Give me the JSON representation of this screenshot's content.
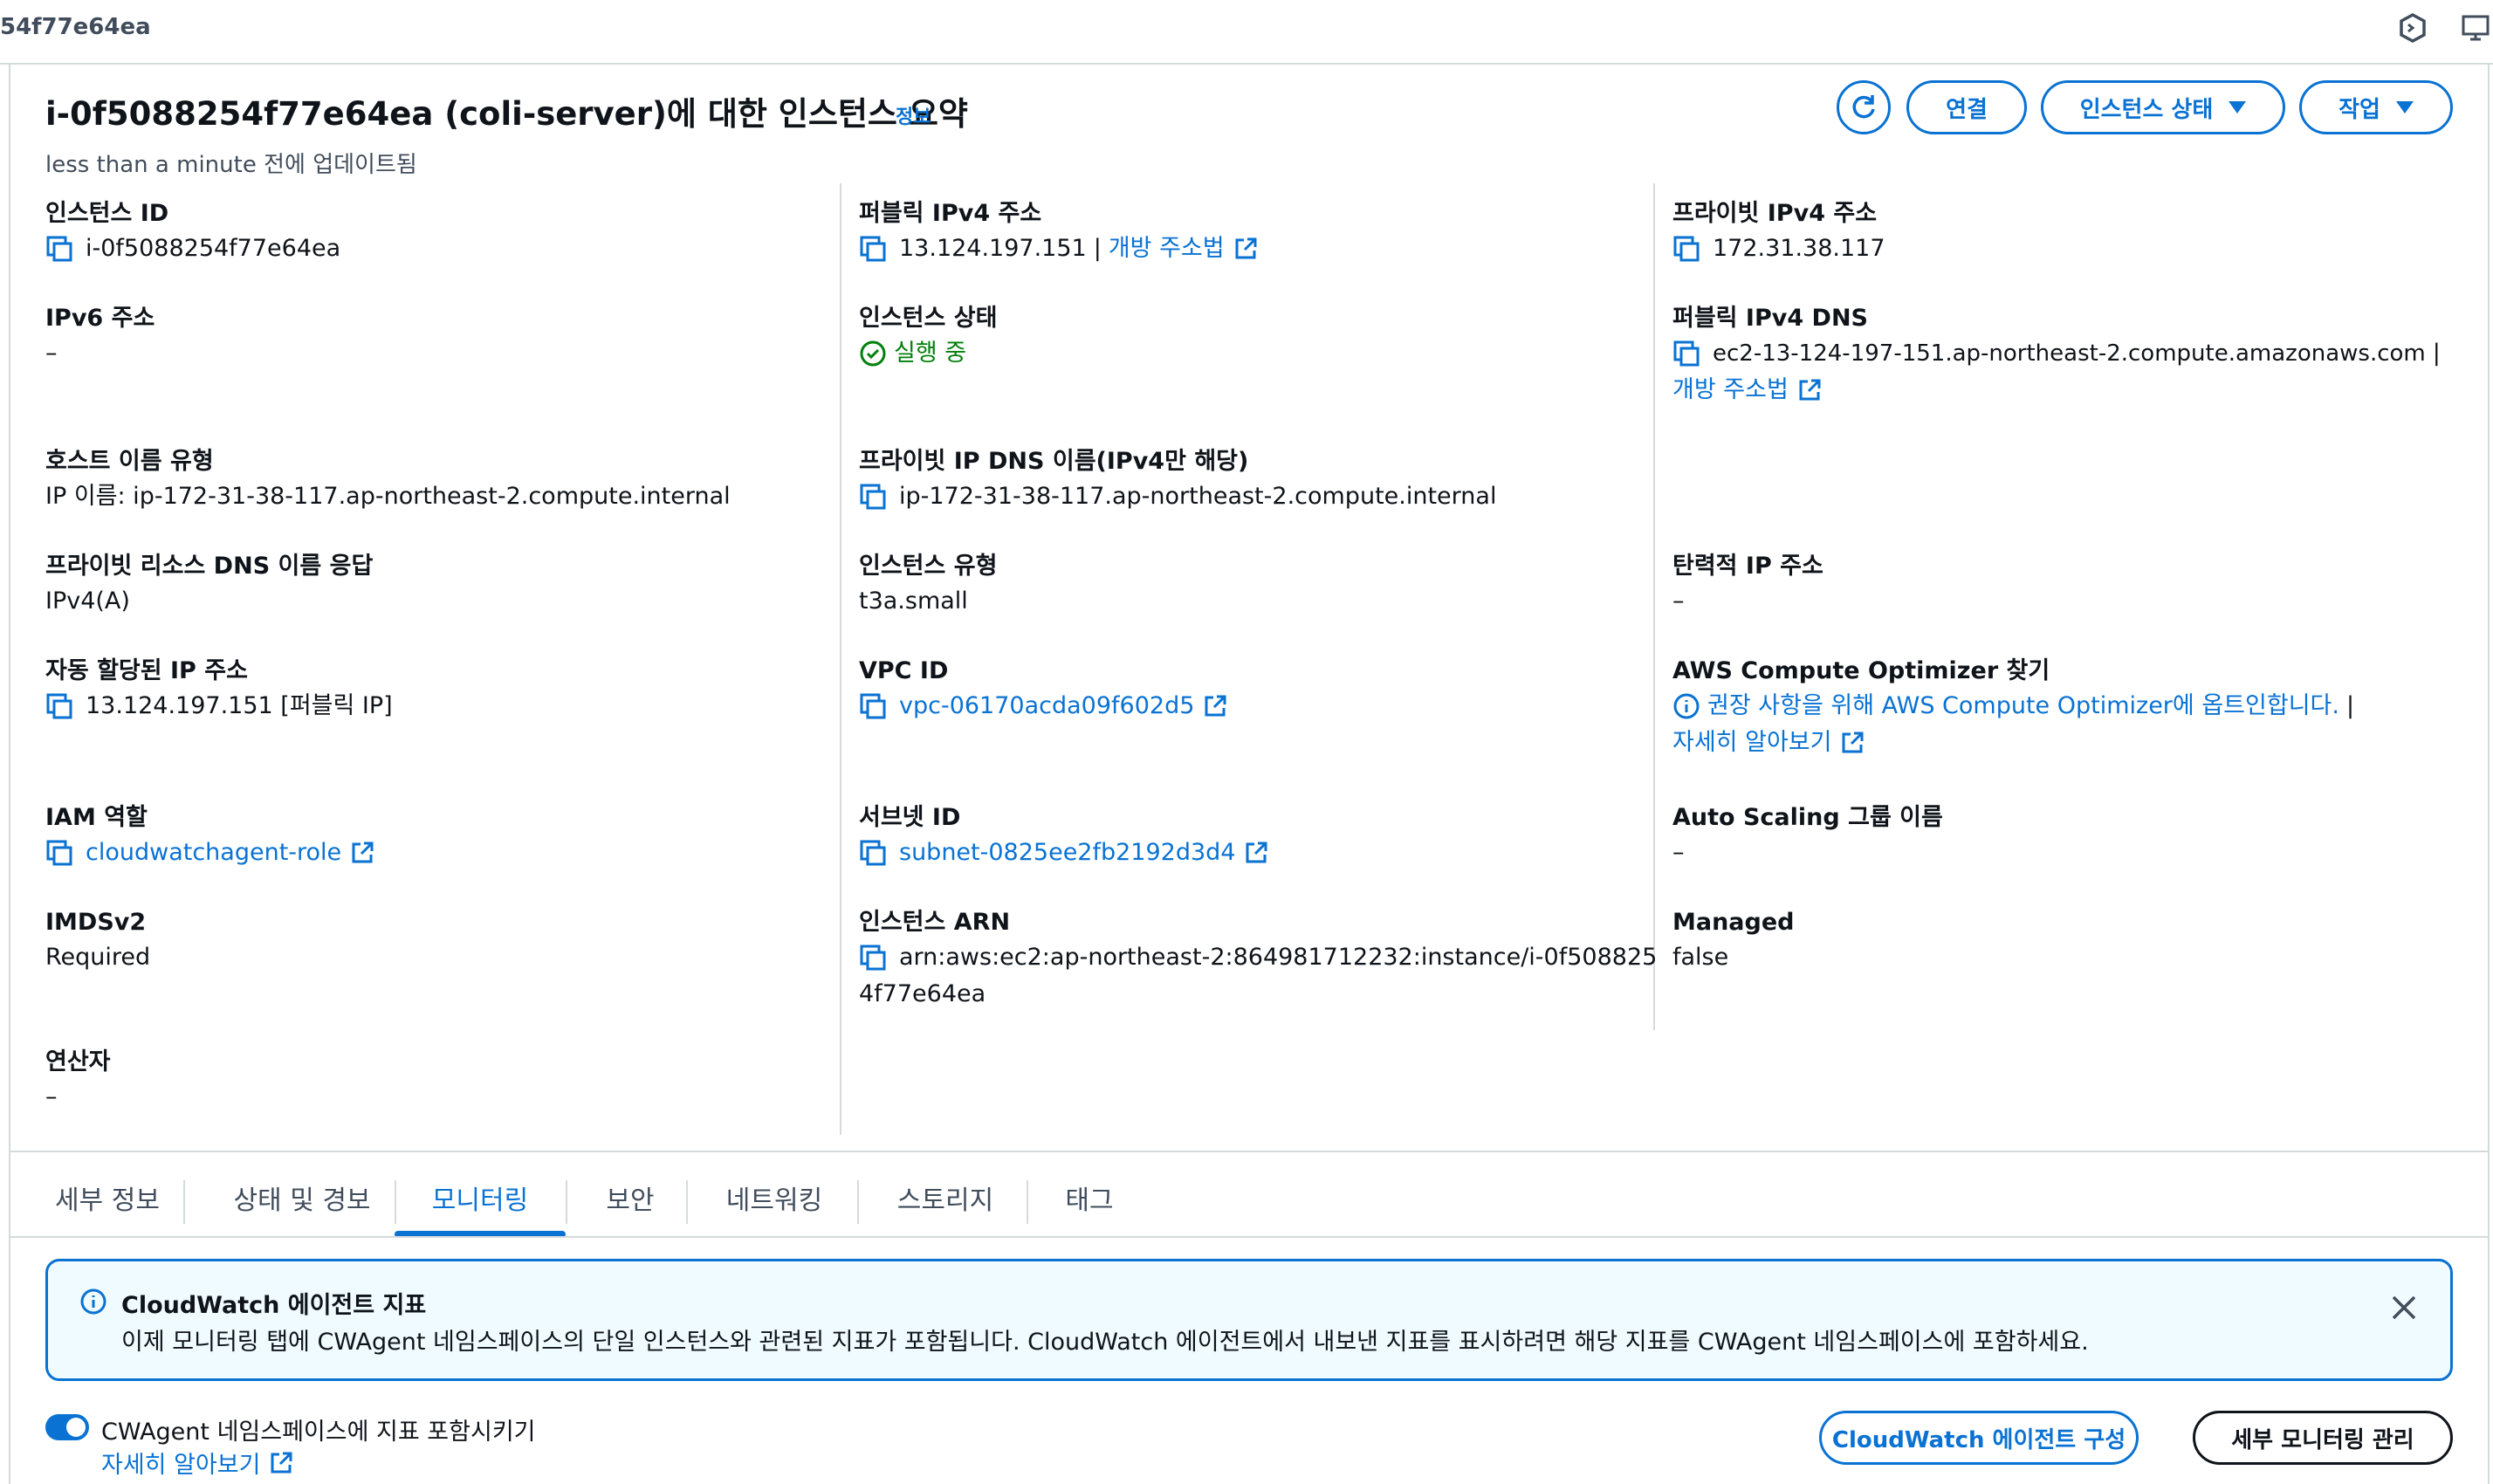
{
  "topbar": {
    "instance_id_fragment": "54f77e64ea"
  },
  "header": {
    "title": "i-0f5088254f77e64ea (coli-server)에 대한 인스턴스 요약",
    "info_link": "정보",
    "updated": "less than a minute 전에 업데이트됨",
    "buttons": {
      "connect": "연결",
      "instance_state": "인스턴스 상태",
      "actions": "작업"
    }
  },
  "summary": {
    "instance_id": {
      "label": "인스턴스 ID",
      "value": "i-0f5088254f77e64ea"
    },
    "ipv6": {
      "label": "IPv6 주소",
      "value": "–"
    },
    "hostname_type": {
      "label": "호스트 이름 유형",
      "value": "IP 이름: ip-172-31-38-117.ap-northeast-2.compute.internal"
    },
    "private_dns_answer": {
      "label": "프라이빗 리소스 DNS 이름 응답",
      "value": "IPv4(A)"
    },
    "auto_ip": {
      "label": "자동 할당된 IP 주소",
      "value": "13.124.197.151 [퍼블릭 IP]"
    },
    "iam_role": {
      "label": "IAM 역할",
      "value": "cloudwatchagent-role"
    },
    "imdsv2": {
      "label": "IMDSv2",
      "value": "Required"
    },
    "operator": {
      "label": "연산자",
      "value": "–"
    },
    "public_ipv4": {
      "label": "퍼블릭 IPv4 주소",
      "value": "13.124.197.151",
      "separator": "|",
      "link": "개방 주소법"
    },
    "instance_state": {
      "label": "인스턴스 상태",
      "value": "실행 중"
    },
    "private_ip_dns": {
      "label": "프라이빗 IP DNS 이름(IPv4만 해당)",
      "value": "ip-172-31-38-117.ap-northeast-2.compute.internal"
    },
    "instance_type": {
      "label": "인스턴스 유형",
      "value": "t3a.small"
    },
    "vpc_id": {
      "label": "VPC ID",
      "value": "vpc-06170acda09f602d5"
    },
    "subnet_id": {
      "label": "서브넷 ID",
      "value": "subnet-0825ee2fb2192d3d4"
    },
    "instance_arn": {
      "label": "인스턴스 ARN",
      "value_line1": "arn:aws:ec2:ap-northeast-2:864981712232:instance/i-0f508825",
      "value_line2": "4f77e64ea"
    },
    "private_ipv4": {
      "label": "프라이빗 IPv4 주소",
      "value": "172.31.38.117"
    },
    "public_dns": {
      "label": "퍼블릭 IPv4 DNS",
      "value": "ec2-13-124-197-151.ap-northeast-2.compute.amazonaws.com",
      "separator": "|",
      "link": "개방 주소법"
    },
    "elastic_ip": {
      "label": "탄력적 IP 주소",
      "value": "–"
    },
    "compute_optimizer": {
      "label": "AWS Compute Optimizer 찾기",
      "value": "권장 사항을 위해 AWS Compute Optimizer에 옵트인합니다.",
      "separator": "|",
      "link": "자세히 알아보기"
    },
    "asg_name": {
      "label": "Auto Scaling 그룹 이름",
      "value": "–"
    },
    "managed": {
      "label": "Managed",
      "value": "false"
    }
  },
  "tabs": [
    "세부 정보",
    "상태 및 경보",
    "모니터링",
    "보안",
    "네트워킹",
    "스토리지",
    "태그"
  ],
  "active_tab": "모니터링",
  "alert": {
    "title": "CloudWatch 에이전트 지표",
    "body": "이제 모니터링 탭에 CWAgent 네임스페이스의 단일 인스턴스와 관련된 지표가 포함됩니다. CloudWatch 에이전트에서 내보낸 지표를 표시하려면 해당 지표를 CWAgent 네임스페이스에 포함하세요."
  },
  "monitoring": {
    "toggle_label": "CWAgent 네임스페이스에 지표 포함시키기",
    "toggle_on": true,
    "learn_more": "자세히 알아보기",
    "configure_button": "CloudWatch 에이전트 구성",
    "manage_button": "세부 모니터링 관리"
  },
  "colors": {
    "accent": "#0972d3",
    "success": "#037f0c",
    "text": "#0f141a",
    "muted": "#414d5c",
    "border": "#d5dbdb",
    "alert_bg": "#f0fbff"
  }
}
